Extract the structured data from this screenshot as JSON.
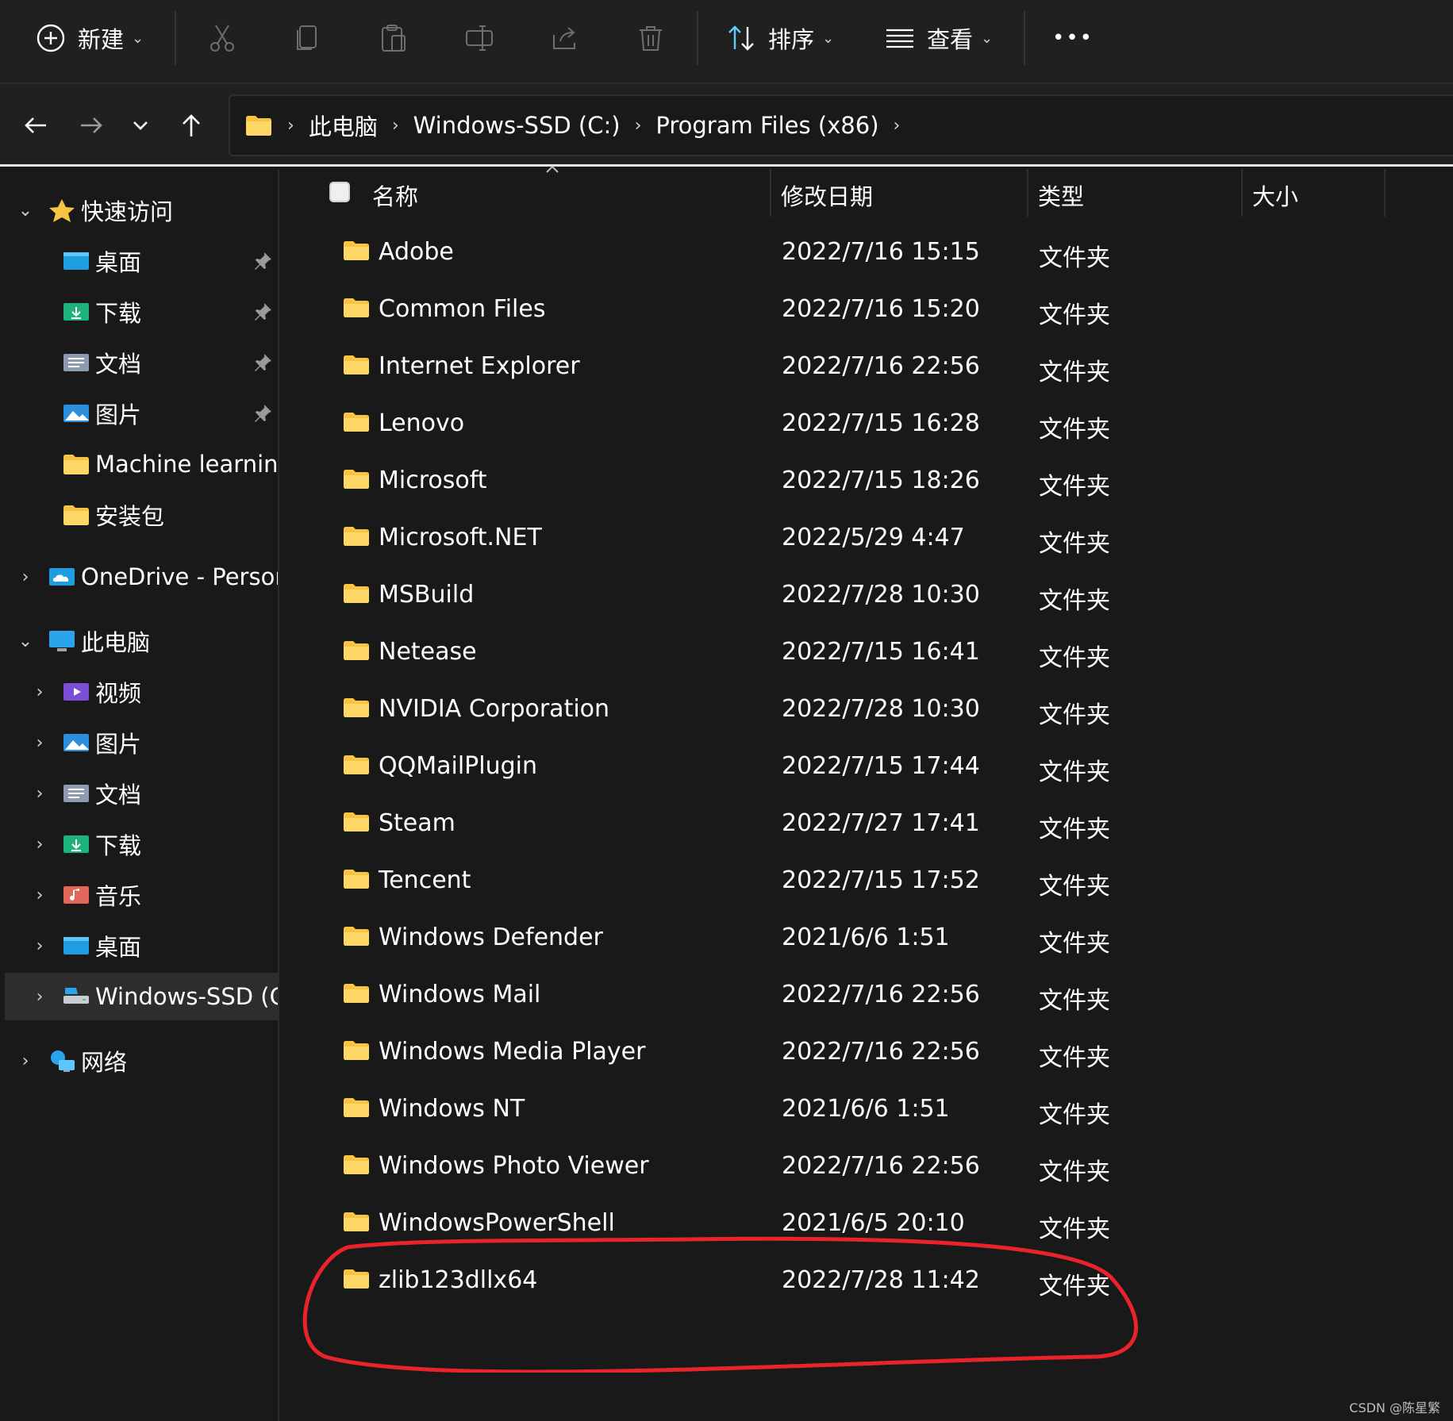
{
  "colors": {
    "folder": "#f6c343",
    "accent": "#60cdff",
    "annotation": "#e8232b"
  },
  "toolbar": {
    "new_label": "新建",
    "sort_label": "排序",
    "view_label": "查看",
    "more_label": "•••",
    "icons": [
      "cut-icon",
      "copy-icon",
      "paste-icon",
      "rename-icon",
      "share-icon",
      "delete-icon"
    ]
  },
  "address": {
    "crumbs": [
      "此电脑",
      "Windows-SSD (C:)",
      "Program Files (x86)"
    ]
  },
  "sidebar": {
    "quick_access": "快速访问",
    "qa_items": [
      "桌面",
      "下载",
      "文档",
      "图片",
      "Machine learning",
      "安装包"
    ],
    "onedrive": "OneDrive - Persona",
    "this_pc": "此电脑",
    "pc_items": [
      "视频",
      "图片",
      "文档",
      "下载",
      "音乐",
      "桌面",
      "Windows-SSD (C:)"
    ],
    "network": "网络"
  },
  "columns": {
    "name": "名称",
    "modified": "修改日期",
    "type": "类型",
    "size": "大小"
  },
  "rows": [
    {
      "name": "Adobe",
      "date": "2022/7/16 15:15",
      "type": "文件夹"
    },
    {
      "name": "Common Files",
      "date": "2022/7/16 15:20",
      "type": "文件夹"
    },
    {
      "name": "Internet Explorer",
      "date": "2022/7/16 22:56",
      "type": "文件夹"
    },
    {
      "name": "Lenovo",
      "date": "2022/7/15 16:28",
      "type": "文件夹"
    },
    {
      "name": "Microsoft",
      "date": "2022/7/15 18:26",
      "type": "文件夹"
    },
    {
      "name": "Microsoft.NET",
      "date": "2022/5/29 4:47",
      "type": "文件夹"
    },
    {
      "name": "MSBuild",
      "date": "2022/7/28 10:30",
      "type": "文件夹"
    },
    {
      "name": "Netease",
      "date": "2022/7/15 16:41",
      "type": "文件夹"
    },
    {
      "name": "NVIDIA Corporation",
      "date": "2022/7/28 10:30",
      "type": "文件夹"
    },
    {
      "name": "QQMailPlugin",
      "date": "2022/7/15 17:44",
      "type": "文件夹"
    },
    {
      "name": "Steam",
      "date": "2022/7/27 17:41",
      "type": "文件夹"
    },
    {
      "name": "Tencent",
      "date": "2022/7/15 17:52",
      "type": "文件夹"
    },
    {
      "name": "Windows Defender",
      "date": "2021/6/6 1:51",
      "type": "文件夹"
    },
    {
      "name": "Windows Mail",
      "date": "2022/7/16 22:56",
      "type": "文件夹"
    },
    {
      "name": "Windows Media Player",
      "date": "2022/7/16 22:56",
      "type": "文件夹"
    },
    {
      "name": "Windows NT",
      "date": "2021/6/6 1:51",
      "type": "文件夹"
    },
    {
      "name": "Windows Photo Viewer",
      "date": "2022/7/16 22:56",
      "type": "文件夹"
    },
    {
      "name": "WindowsPowerShell",
      "date": "2021/6/5 20:10",
      "type": "文件夹"
    },
    {
      "name": "zlib123dllx64",
      "date": "2022/7/28 11:42",
      "type": "文件夹"
    }
  ],
  "watermark": "CSDN @陈星繁"
}
